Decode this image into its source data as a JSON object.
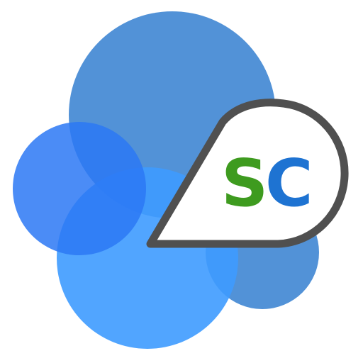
{
  "logo": {
    "letters": {
      "s": "S",
      "c": "C"
    },
    "colors": {
      "circle_top": "#4A90D9",
      "circle_left": "#2F7BF3",
      "circle_bottom": "#3B9CFF",
      "circle_right": "#3D8BD6",
      "overlap_dark": "#1565E8",
      "badge_fill": "#FFFFFF",
      "badge_outline": "#505050",
      "letter_s": "#3E9B1F",
      "letter_c": "#1E73D2"
    }
  }
}
